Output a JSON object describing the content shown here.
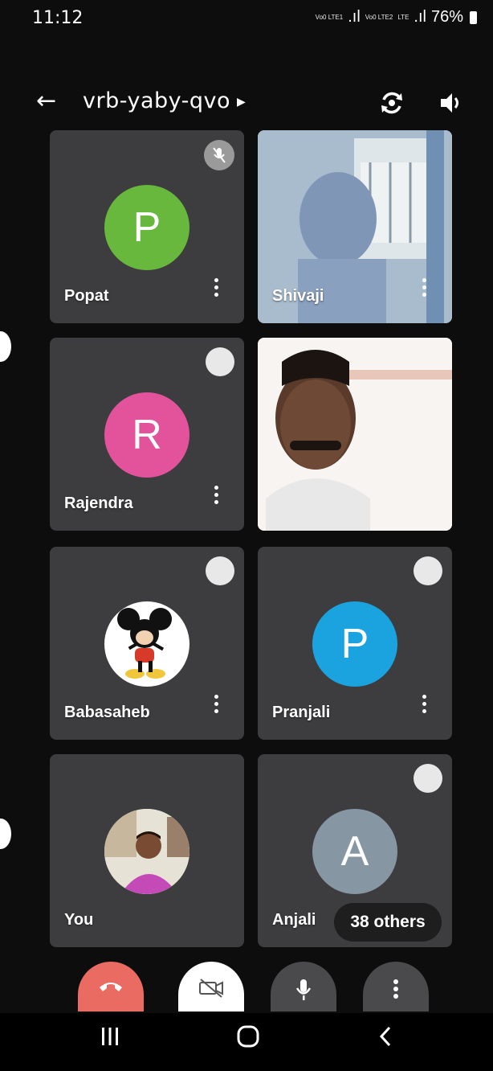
{
  "status": {
    "time": "11:12",
    "sim1": "Vo0 LTE1",
    "sim2": "Vo0 LTE2",
    "lte": "LTE",
    "battery": "76%"
  },
  "header": {
    "meeting_code": "vrb-yaby-qvo"
  },
  "participants": [
    {
      "name": "Popat",
      "initial": "P",
      "color": "#67b83d",
      "muted": true
    },
    {
      "name": "Shivaji",
      "video": true
    },
    {
      "name": "Rajendra",
      "initial": "R",
      "color": "#e2539b"
    },
    {
      "name": "",
      "video": true
    },
    {
      "name": "Babasaheb",
      "avatar": "mickey-image"
    },
    {
      "name": "Pranjali",
      "initial": "P",
      "color": "#1ba3e0"
    },
    {
      "name": "You",
      "avatar": "profile-photo"
    },
    {
      "name": "Anjali",
      "initial": "A",
      "color": "#8696a3"
    }
  ],
  "others_label": "38 others",
  "colors": {
    "end_call": "#ea6b62",
    "background": "#0d0d0d",
    "tile": "#3d3d3f"
  }
}
